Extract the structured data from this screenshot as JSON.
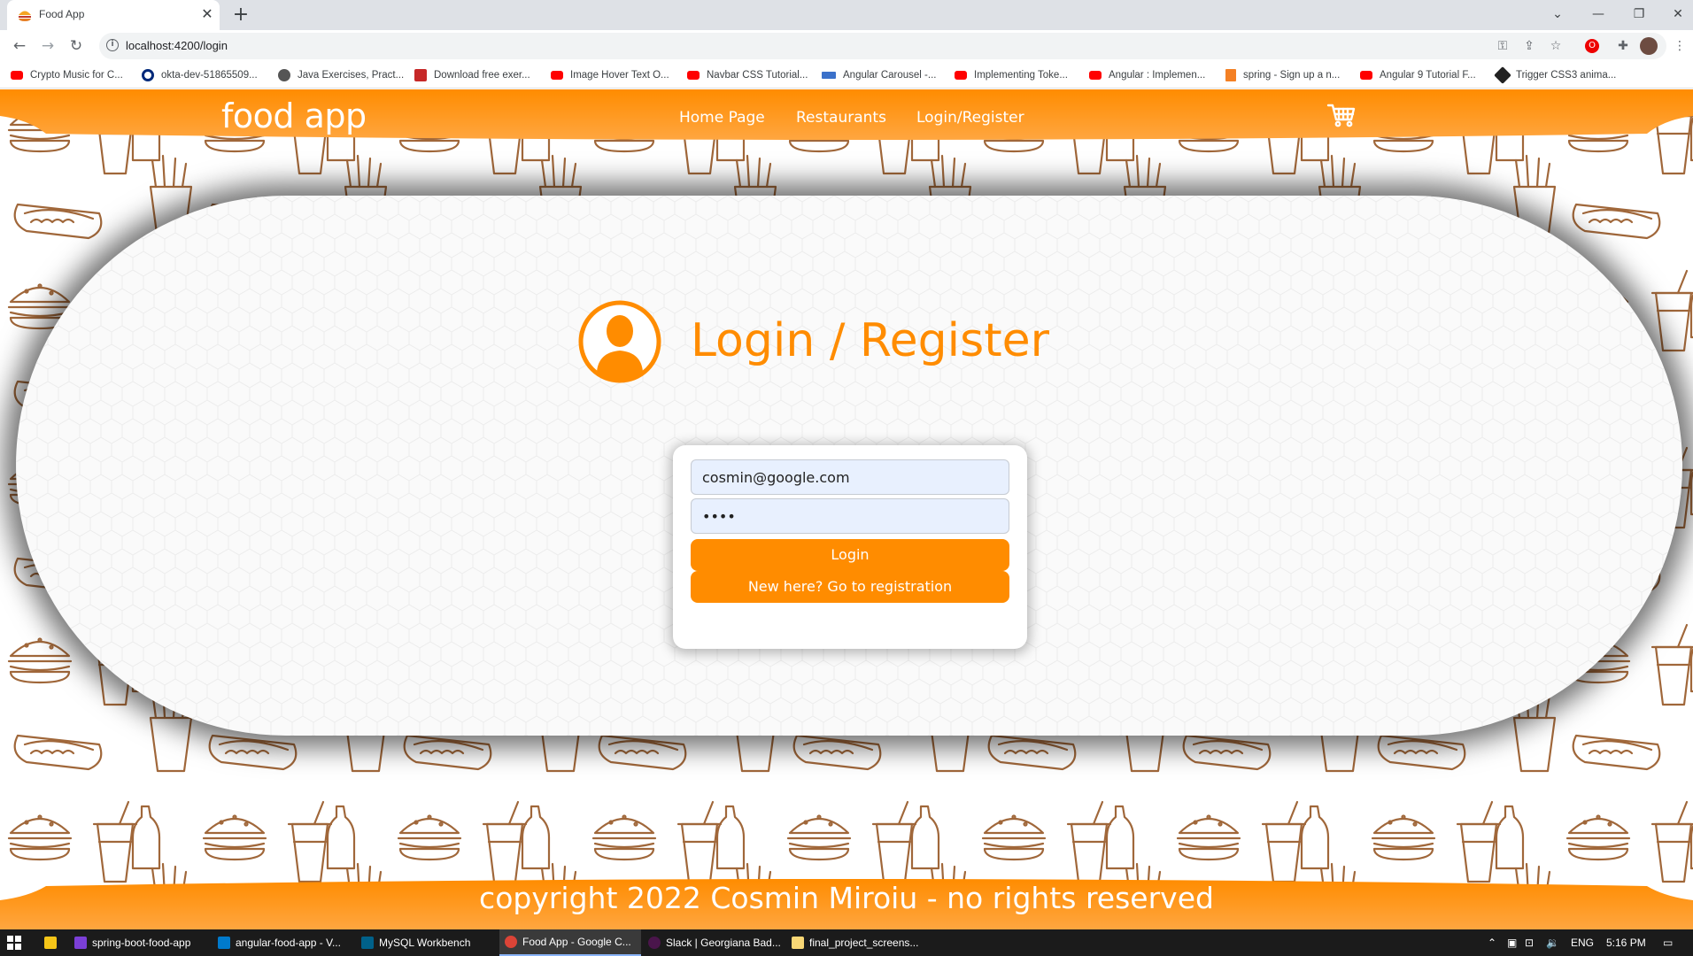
{
  "browser": {
    "tab_title": "Food App",
    "tab_close": "✕",
    "new_tab": "+",
    "url": "localhost:4200/login",
    "window_controls": {
      "minimize": "—",
      "restore": "❐",
      "close": "✕",
      "dropdown": "⌄"
    },
    "nav": {
      "back": "←",
      "forward": "→",
      "reload": "↻"
    },
    "bookmarks": [
      {
        "label": "Crypto Music for C...",
        "icon": "youtube-icon"
      },
      {
        "label": "okta-dev-51865509...",
        "icon": "okta-icon"
      },
      {
        "label": "Java Exercises, Pract...",
        "icon": "globe-icon"
      },
      {
        "label": "Download free exer...",
        "icon": "download-site-icon"
      },
      {
        "label": "Image Hover Text O...",
        "icon": "youtube-icon"
      },
      {
        "label": "Navbar CSS Tutorial...",
        "icon": "youtube-icon"
      },
      {
        "label": "Angular Carousel -...",
        "icon": "mdb-icon"
      },
      {
        "label": "Implementing Toke...",
        "icon": "youtube-icon"
      },
      {
        "label": "Angular : Implemen...",
        "icon": "youtube-icon"
      },
      {
        "label": "spring - Sign up a n...",
        "icon": "stackoverflow-icon"
      },
      {
        "label": "Angular 9 Tutorial F...",
        "icon": "youtube-icon"
      },
      {
        "label": "Trigger CSS3 anima...",
        "icon": "codepen-icon"
      }
    ]
  },
  "app": {
    "brand": "food app",
    "nav": [
      "Home Page",
      "Restaurants",
      "Login/Register"
    ],
    "title": "Login / Register",
    "email_value": "cosmin@google.com",
    "password_value": "1234",
    "login_button": "Login",
    "register_button": "New here? Go to registration",
    "footer": "copyright 2022 Cosmin Miroiu - no rights reserved"
  },
  "taskbar": {
    "apps": [
      {
        "label": "spring-boot-food-app",
        "icon": "intellij-icon"
      },
      {
        "label": "angular-food-app - V...",
        "icon": "vscode-icon"
      },
      {
        "label": "MySQL Workbench",
        "icon": "mysql-workbench-icon"
      },
      {
        "label": "Food App - Google C...",
        "icon": "chrome-icon",
        "active": true
      },
      {
        "label": "Slack | Georgiana Bad...",
        "icon": "slack-icon"
      },
      {
        "label": "final_project_screens...",
        "icon": "folder-icon"
      }
    ],
    "language": "ENG",
    "time": "5:16 PM"
  },
  "colors": {
    "accent": "#ff8c00",
    "doodle": "#a0673a",
    "field_bg": "#e8f0fe"
  }
}
